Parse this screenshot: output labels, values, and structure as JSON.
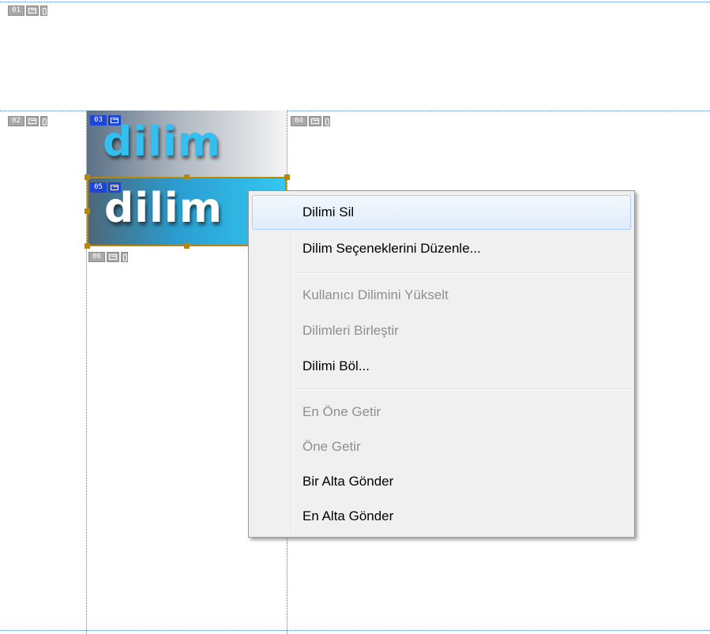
{
  "slice_tags": {
    "t01": "01",
    "t02": "02",
    "t03": "03",
    "t04": "04",
    "t05": "05",
    "t06": "06"
  },
  "slices": {
    "s03_text": "dilim",
    "s05_text": "dilim"
  },
  "context_menu": {
    "items": [
      {
        "label": "Dilimi Sil",
        "enabled": true
      },
      {
        "label": "Dilim Seçeneklerini Düzenle...",
        "enabled": true
      },
      {
        "label": "Kullanıcı Dilimini Yükselt",
        "enabled": false
      },
      {
        "label": "Dilimleri Birleştir",
        "enabled": false
      },
      {
        "label": "Dilimi Böl...",
        "enabled": true
      },
      {
        "label": "En Öne Getir",
        "enabled": false
      },
      {
        "label": "Öne Getir",
        "enabled": false
      },
      {
        "label": "Bir Alta Gönder",
        "enabled": true
      },
      {
        "label": "En Alta Gönder",
        "enabled": true
      }
    ]
  },
  "colors": {
    "guide": "#4a7bd4",
    "active_tag": "#1f45d8",
    "selection": "#b8860b"
  }
}
